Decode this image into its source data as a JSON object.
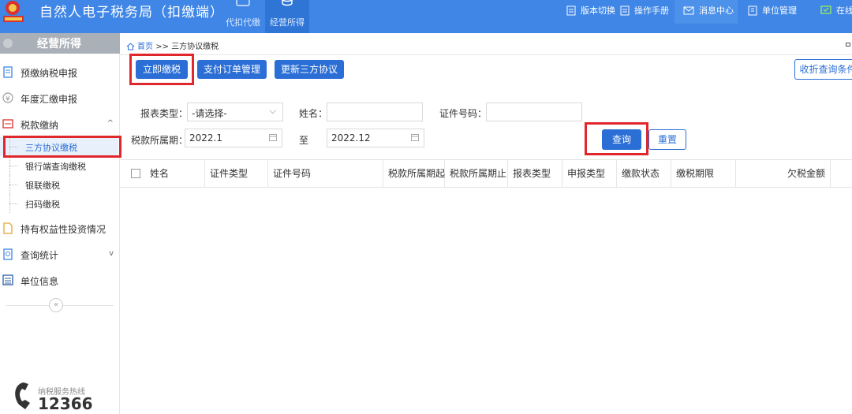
{
  "header": {
    "title": "自然人电子税务局（扣缴端）",
    "modules": [
      {
        "label": "代扣代缴",
        "icon": "wallet-icon"
      },
      {
        "label": "经营所得",
        "icon": "coins-icon"
      }
    ],
    "right_items": [
      {
        "label": "版本切换",
        "icon": "switch-icon"
      },
      {
        "label": "操作手册",
        "icon": "manual-icon"
      },
      {
        "label": "消息中心",
        "icon": "mail-icon"
      },
      {
        "label": "单位管理",
        "icon": "building-icon"
      },
      {
        "label": "在线",
        "icon": "chat-icon"
      }
    ]
  },
  "sidebar": {
    "title": "经营所得",
    "items": [
      {
        "label": "预缴纳税申报",
        "icon": "document-icon"
      },
      {
        "label": "年度汇缴申报",
        "icon": "yen-icon"
      },
      {
        "label": "税款缴纳",
        "icon": "tax-icon",
        "caret": "^"
      },
      {
        "label": "持有权益性投资情况",
        "icon": "file-icon"
      },
      {
        "label": "查询统计",
        "icon": "query-icon",
        "caret": "v"
      },
      {
        "label": "单位信息",
        "icon": "list-icon"
      }
    ],
    "sub_items": [
      {
        "label": "三方协议缴税"
      },
      {
        "label": "银行端查询缴税"
      },
      {
        "label": "银联缴税"
      },
      {
        "label": "扫码缴税"
      }
    ],
    "collapse": "«",
    "hotline_label": "纳税服务热线",
    "hotline_number": "12366"
  },
  "breadcrumb": {
    "home": "首页",
    "sep": ">>",
    "current": "三方协议缴税"
  },
  "toolbar": {
    "pay_now": "立即缴税",
    "payment_orders": "支付订单管理",
    "update_agreement": "更新三方协议",
    "collapse_query": "收折查询条件"
  },
  "form": {
    "report_type_label": "报表类型：",
    "report_type_value": "-请选择-",
    "name_label": "姓名：",
    "name_value": "",
    "id_label": "证件号码：",
    "id_value": "",
    "period_label": "税款所属期：",
    "period_start": "2022.1",
    "to_label": "至",
    "period_end": "2022.12",
    "query_button": "查询",
    "reset_button": "重置"
  },
  "table": {
    "columns": [
      "姓名",
      "证件类型",
      "证件号码",
      "税款所属期起",
      "税款所属期止",
      "报表类型",
      "申报类型",
      "缴款状态",
      "缴税期限",
      "欠税金额"
    ],
    "rows": []
  },
  "colors": {
    "topbar": "#3f86e6",
    "primary": "#2b6fd6",
    "highlight": "#e0272c"
  }
}
